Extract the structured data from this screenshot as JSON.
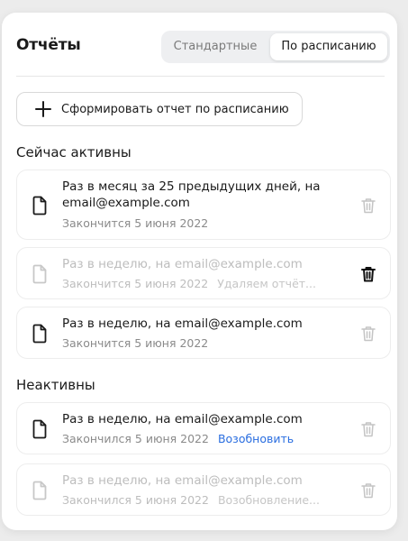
{
  "header": {
    "title": "Отчёты",
    "tabs": [
      {
        "label": "Стандартные",
        "selected": false
      },
      {
        "label": "По расписанию",
        "selected": true
      }
    ]
  },
  "create_button": {
    "label": "Сформировать отчет по расписанию",
    "icon": "plus-icon"
  },
  "sections": {
    "active": {
      "title": "Сейчас активны",
      "items": [
        {
          "text": "Раз в месяц за 25 предыдущих дней, на email@example.com",
          "status": "Закончится 5 июня 2022",
          "extra": ""
        },
        {
          "text": "Раз в неделю, на email@example.com",
          "status": "Закончится 5 июня 2022",
          "extra": "Удаляем отчёт..."
        },
        {
          "text": "Раз в неделю, на email@example.com",
          "status": "Закончится 5 июня 2022",
          "extra": ""
        }
      ]
    },
    "inactive": {
      "title": "Неактивны",
      "items": [
        {
          "text": "Раз в неделю, на email@example.com",
          "status": "Закончился 5 июня 2022",
          "action": "Возобновить"
        },
        {
          "text": "Раз в неделю, на email@example.com",
          "status": "Закончился 5 июня 2022",
          "extra": "Возобновление..."
        }
      ]
    }
  },
  "colors": {
    "link": "#2a6ee0",
    "muted_text": "#bdbdbd",
    "secondary_text": "#8a8a8a",
    "segment_bg": "#eeeff1"
  }
}
